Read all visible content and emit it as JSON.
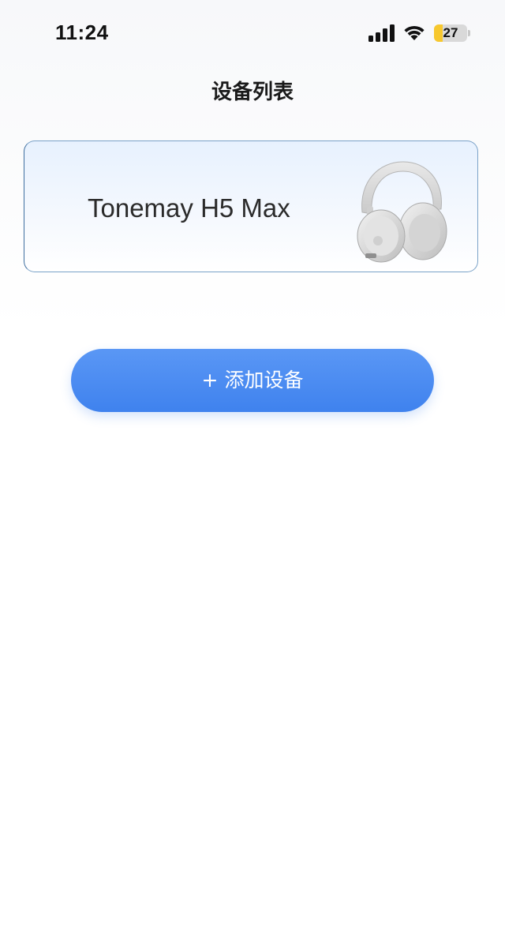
{
  "status_bar": {
    "time": "11:24",
    "battery_level": "27",
    "battery_color": "#f7c82e",
    "icons": [
      "signal-icon",
      "wifi-icon",
      "battery-icon"
    ]
  },
  "header": {
    "title": "设备列表"
  },
  "devices": [
    {
      "name": "Tonemay H5 Max",
      "image": "headphones-image"
    }
  ],
  "actions": {
    "add_device_label": "+ 添加设备"
  },
  "colors": {
    "accent": "#4a8af2",
    "card_border": "#7aa2c8",
    "card_bg_top": "#e7f1fe"
  }
}
